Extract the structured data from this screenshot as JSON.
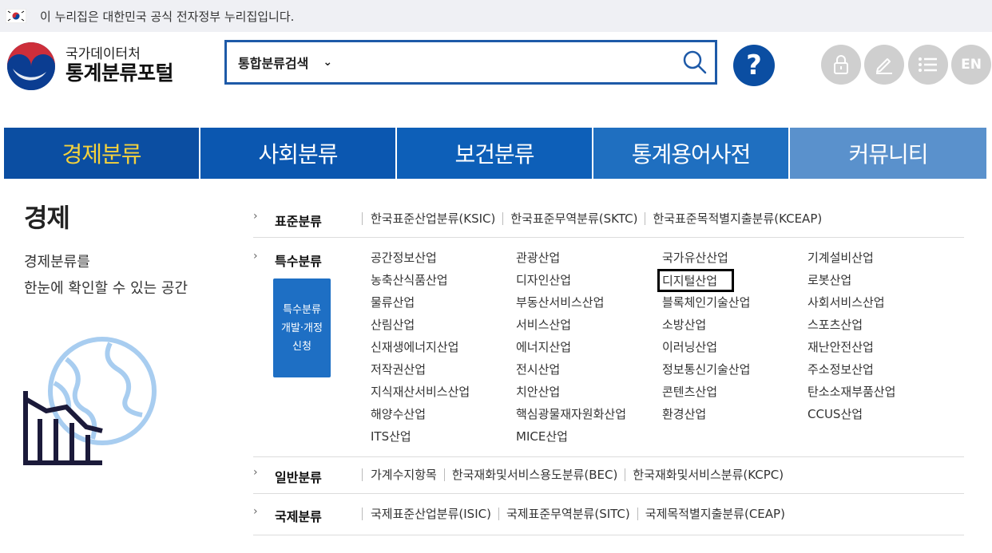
{
  "gov_bar": {
    "text": "이 누리집은 대한민국 공식 전자정부 누리집입니다."
  },
  "header": {
    "logo_sub": "국가데이터처",
    "logo_main": "통계분류포털",
    "search": {
      "select_label": "통합분류검색",
      "value": "",
      "placeholder": ""
    },
    "help_label": "?",
    "en_label": "EN"
  },
  "colors": {
    "brand_blue": "#0b4ea2",
    "nav_active_text": "#f5d23c",
    "util_gray": "#cfcfcf",
    "apply_button": "#1e6fc4"
  },
  "nav": [
    {
      "label": "경제분류",
      "bg": "#0b4ea2",
      "color": "#f5d23c",
      "active": true
    },
    {
      "label": "사회분류",
      "bg": "#0b57b0",
      "color": "#ffffff"
    },
    {
      "label": "보건분류",
      "bg": "#0d5fb8",
      "color": "#ffffff"
    },
    {
      "label": "통계용어사전",
      "bg": "#1f6fc0",
      "color": "#ffffff"
    },
    {
      "label": "커뮤니티",
      "bg": "#5a91cc",
      "color": "#ffffff"
    }
  ],
  "page": {
    "title": "경제",
    "desc_line1": "경제분류를",
    "desc_line2": "한눈에 확인할 수 있는 공간"
  },
  "categories": {
    "standard": {
      "heading": "표준분류",
      "links": [
        "한국표준산업분류(KSIC)",
        "한국표준무역분류(SKTC)",
        "한국표준목적별지출분류(KCEAP)"
      ]
    },
    "special": {
      "heading": "특수분류",
      "apply_button": [
        "특수분류",
        "개발·개정",
        "신청"
      ],
      "columns": [
        [
          "공간정보산업",
          "농축산식품산업",
          "물류산업",
          "산림산업",
          "신재생에너지산업",
          "저작권산업",
          "지식재산서비스산업",
          "해양수산업",
          "ITS산업"
        ],
        [
          "관광산업",
          "디자인산업",
          "부동산서비스산업",
          "서비스산업",
          "에너지산업",
          "전시산업",
          "치안산업",
          "핵심광물재자원화산업",
          "MICE산업"
        ],
        [
          "국가유산산업",
          "디지털산업",
          "블록체인기술산업",
          "소방산업",
          "이러닝산업",
          "정보통신기술산업",
          "콘텐츠산업",
          "환경산업"
        ],
        [
          "기계설비산업",
          "로봇산업",
          "사회서비스산업",
          "스포츠산업",
          "재난안전산업",
          "주소정보산업",
          "탄소소재부품산업",
          "CCUS산업"
        ]
      ]
    },
    "general": {
      "heading": "일반분류",
      "links": [
        "가계수지항목",
        "한국재화및서비스용도분류(BEC)",
        "한국재화및서비스분류(KCPC)"
      ]
    },
    "international": {
      "heading": "국제분류",
      "links": [
        "국제표준산업분류(ISIC)",
        "국제표준무역분류(SITC)",
        "국제목적별지출분류(CEAP)"
      ]
    }
  }
}
